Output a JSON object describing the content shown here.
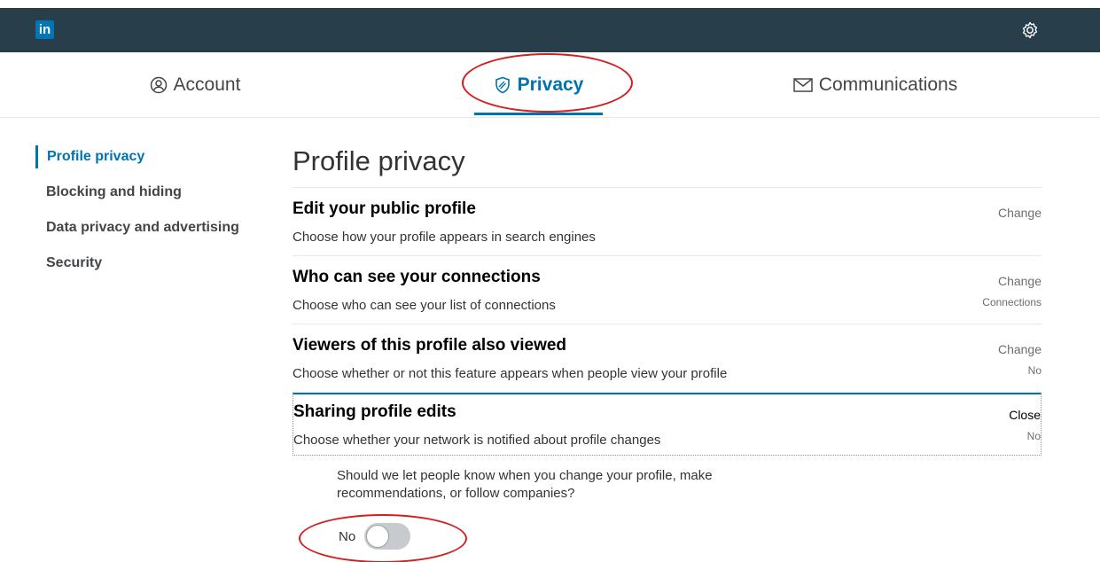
{
  "header": {
    "logo_text": "in",
    "settings_icon": "gear-icon",
    "bar_color": "#283e4a",
    "brand_color": "#0077b5"
  },
  "tabs": [
    {
      "label": "Account",
      "icon": "user-circle-icon"
    },
    {
      "label": "Privacy",
      "icon": "shield-icon",
      "active": true
    },
    {
      "label": "Communications",
      "icon": "envelope-icon"
    }
  ],
  "sidebar": {
    "items": [
      {
        "label": "Profile privacy",
        "active": true
      },
      {
        "label": "Blocking and hiding"
      },
      {
        "label": "Data privacy and advertising"
      },
      {
        "label": "Security"
      }
    ]
  },
  "main": {
    "title": "Profile privacy",
    "rows": [
      {
        "title": "Edit your public profile",
        "desc": "Choose how your profile appears in search engines",
        "action": "Change",
        "value": ""
      },
      {
        "title": "Who can see your connections",
        "desc": "Choose who can see your list of connections",
        "action": "Change",
        "value": "Connections"
      },
      {
        "title": "Viewers of this profile also viewed",
        "desc": "Choose whether or not this feature appears when people view your profile",
        "action": "Change",
        "value": "No"
      },
      {
        "title": "Sharing profile edits",
        "desc": "Choose whether your network is notified about profile changes",
        "action": "Close",
        "value": "No"
      }
    ],
    "expanded": {
      "question": "Should we let people know when you change your profile, make recommendations, or follow companies?",
      "toggle_label": "No",
      "toggle_on": false
    }
  },
  "colors": {
    "accent": "#0073b1",
    "annotation": "#d41f1f"
  }
}
